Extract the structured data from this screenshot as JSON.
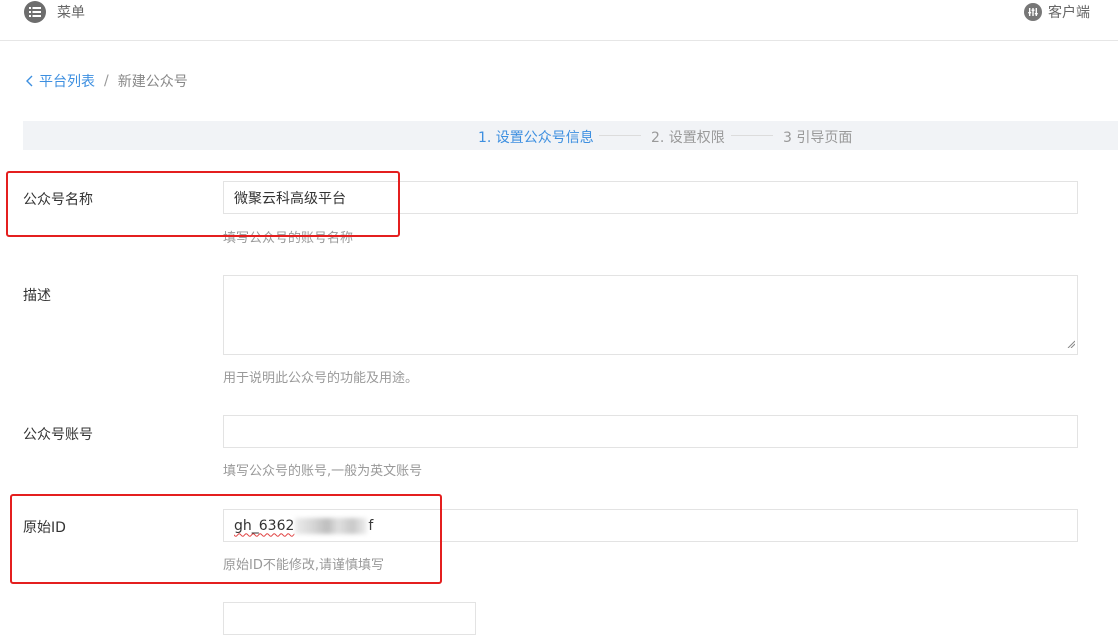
{
  "topbar": {
    "menu_label": "菜单",
    "client_label": "客户端"
  },
  "breadcrumb": {
    "back_label": "平台列表",
    "separator": "/",
    "current": "新建公众号"
  },
  "steps": [
    {
      "label": "1. 设置公众号信息",
      "active": true
    },
    {
      "label": "2. 设置权限",
      "active": false
    },
    {
      "label": "3 引导页面",
      "active": false
    }
  ],
  "form": {
    "name": {
      "label": "公众号名称",
      "value": "微聚云科高级平台",
      "hint": "填写公众号的账号名称"
    },
    "description": {
      "label": "描述",
      "value": "",
      "hint": "用于说明此公众号的功能及用途。"
    },
    "account": {
      "label": "公众号账号",
      "value": "",
      "hint": "填写公众号的账号,一般为英文账号"
    },
    "original_id": {
      "label": "原始ID",
      "value_prefix": "gh_6362",
      "value_suffix": "f",
      "hint": "原始ID不能修改,请谨慎填写"
    }
  },
  "colors": {
    "accent": "#3d8fe0",
    "highlight_box": "#e41f1f"
  }
}
